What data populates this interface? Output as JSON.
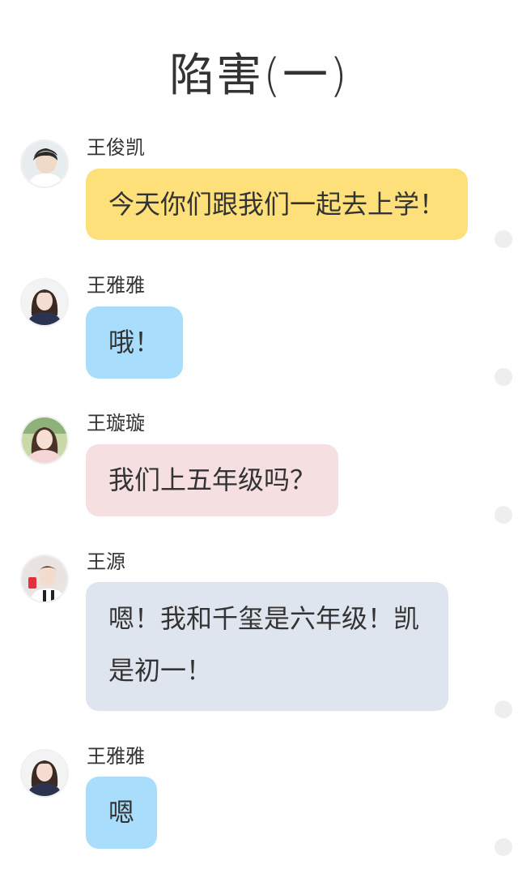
{
  "title": "陷害(一)",
  "colors": {
    "yellow": "#fde07a",
    "blue": "#a8defc",
    "pink": "#f5dfe0",
    "gray": "#dfe5ee"
  },
  "messages": [
    {
      "sender": "王俊凯",
      "text": "今天你们跟我们一起去上学！",
      "avatar_icon": "boy-avatar-icon"
    },
    {
      "sender": "王雅雅",
      "text": "哦！",
      "avatar_icon": "girl-avatar-icon"
    },
    {
      "sender": "王璇璇",
      "text": "我们上五年级吗？",
      "avatar_icon": "girl-avatar-icon"
    },
    {
      "sender": "王源",
      "text": "嗯！我和千玺是六年级！凯是初一！",
      "avatar_icon": "boy-avatar-icon"
    },
    {
      "sender": "王雅雅",
      "text": "嗯",
      "avatar_icon": "girl-avatar-icon"
    }
  ]
}
